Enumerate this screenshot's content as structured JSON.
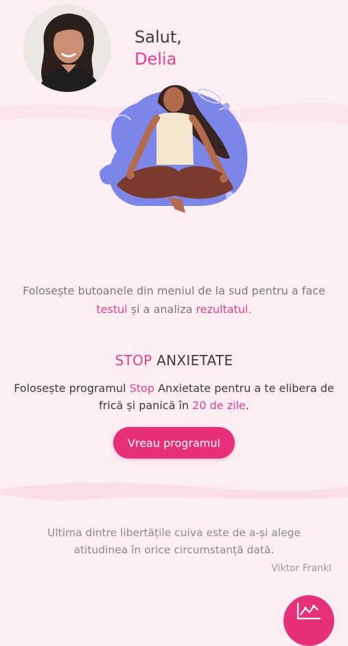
{
  "greeting": {
    "hello": "Salut,",
    "user_name": "Delia"
  },
  "intro": {
    "part1": "Folosește butoanele din meniul de la sud pentru a face ",
    "link_test": "testul",
    "part2": " și a analiza ",
    "link_result": "rezultatul",
    "part3": "."
  },
  "program": {
    "title_highlight": "STOP",
    "title_rest": " ANXIETATE",
    "desc_part1": "Folosește programul ",
    "desc_highlight1": "Stop",
    "desc_part2": " Anxietate pentru a te elibera de frică și panică în ",
    "desc_highlight2": "20 de zile",
    "desc_part3": ".",
    "button_label": "Vreau programul"
  },
  "quote": {
    "text": "Ultima dintre libertățile cuiva este de a-și alege atitudinea în orice circumstanță dată.",
    "author": "Viktor Frankl"
  },
  "colors": {
    "accent": "#e83e8c",
    "background": "#fdeef4",
    "illustration_blue": "#7b86e8"
  },
  "icons": {
    "fab": "chart-line-icon"
  }
}
